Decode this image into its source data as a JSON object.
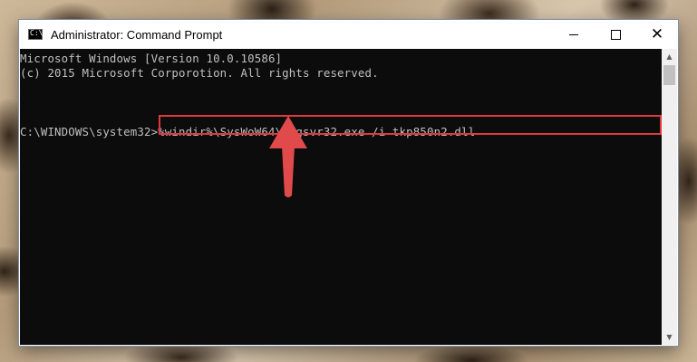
{
  "window": {
    "title": "Administrator: Command Prompt",
    "app_icon_glyph": "C:\\",
    "controls": {
      "minimize": "minimize-icon",
      "maximize": "maximize-icon",
      "close": "close-icon",
      "close_glyph": "✕"
    }
  },
  "console": {
    "lines": [
      "Microsoft Windows [Version 10.0.10586]",
      "(c) 2015 Microsoft Corporotion. All rights reserved."
    ],
    "prompt": "C:\\WINDOWS\\system32>",
    "command": "%windir%\\SysWoW64\\regsvr32.exe /i tkp850n2.dll"
  },
  "scrollbar": {
    "up_glyph": "▲",
    "down_glyph": "▼"
  },
  "colors": {
    "console_background": "#0c0c0c",
    "console_text": "#c0c0c0",
    "highlight_border": "#e0383b",
    "arrow": "#e04a4a"
  }
}
